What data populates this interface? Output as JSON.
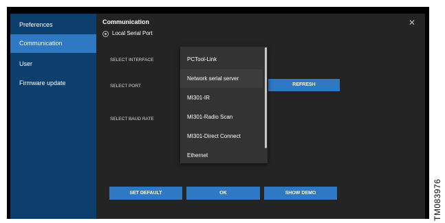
{
  "sidebar": {
    "title": "Preferences",
    "items": [
      {
        "label": "Communication",
        "active": true
      },
      {
        "label": "User",
        "active": false
      },
      {
        "label": "Firmware update",
        "active": false
      }
    ]
  },
  "panel": {
    "title": "Communication",
    "close_icon": "close-icon",
    "radio_label": "Local Serial Port",
    "labels": {
      "select_interface": "SELECT INTERFACE",
      "select_port": "SELECT PORT",
      "select_baud_rate": "SELECT BAUD RATE"
    },
    "refresh_label": "REFRESH"
  },
  "dropdown": {
    "options": [
      "PCTool-Link",
      "Network serial server",
      "MI301-IR",
      "MI301-Radio Scan",
      "MI301-Direct Connect",
      "Ethernet"
    ]
  },
  "footer": {
    "set_default_label": "SET DEFAULT",
    "ok_label": "OK",
    "show_demo_label": "SHOW DEMO"
  },
  "watermark": "TM083976",
  "colors": {
    "accent": "#2f78c4",
    "sidebar": "#0c3f6e",
    "content": "#242424",
    "dropdown": "#333333"
  }
}
